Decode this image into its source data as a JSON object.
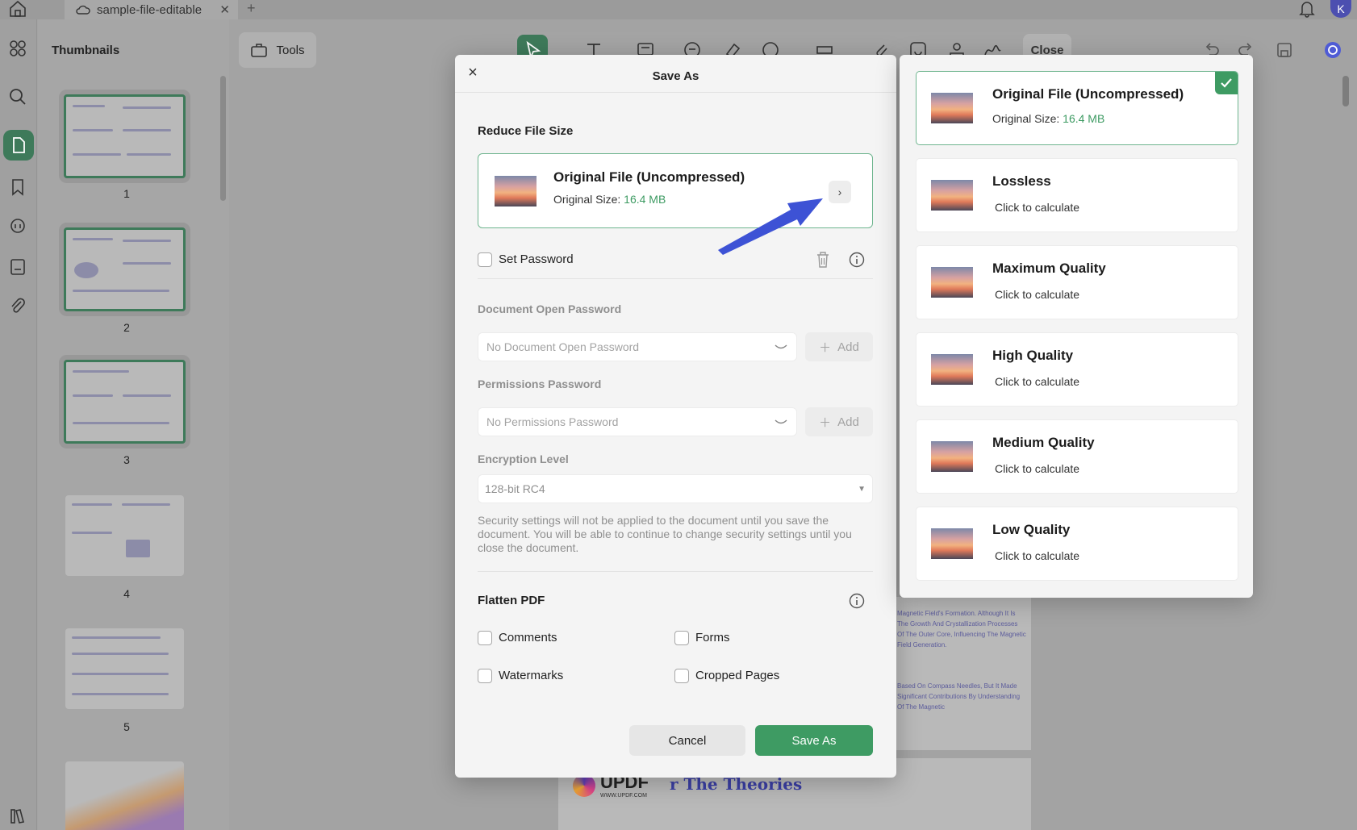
{
  "tab": {
    "title": "sample-file-editable"
  },
  "user": {
    "avatar_initial": "K"
  },
  "thumbnails": {
    "title": "Thumbnails",
    "pages": [
      "1",
      "2",
      "3",
      "4",
      "5"
    ]
  },
  "tools": {
    "label": "Tools"
  },
  "toolbar": {
    "close_label": "Close"
  },
  "document": {
    "logo_name": "UPDF",
    "logo_url": "WWW.UPDF.COM",
    "heading_fragment": "r The Theories",
    "snippet_1": "Magnetic Field's Formation. Although It Is The Growth And Crystallization Processes Of The Outer Core, Influencing The Magnetic Field Generation.",
    "snippet_2": "Based On Compass Needles, But It Made Significant Contributions By Understanding Of The Magnetic"
  },
  "dialog": {
    "title": "Save As",
    "reduce_label": "Reduce File Size",
    "selected": {
      "title": "Original File (Uncompressed)",
      "size_prefix": "Original Size: ",
      "size_value": "16.4 MB"
    },
    "set_password_label": "Set Password",
    "open_pw_label": "Document Open Password",
    "open_pw_placeholder": "No Document Open Password",
    "perm_pw_label": "Permissions Password",
    "perm_pw_placeholder": "No Permissions Password",
    "add_label": "Add",
    "encryption_label": "Encryption Level",
    "encryption_value": "128-bit RC4",
    "security_note": "Security settings will not be applied to the document until you save the document. You will be able to continue to change security settings until you close the document.",
    "flatten_label": "Flatten PDF",
    "flatten": {
      "comments": "Comments",
      "forms": "Forms",
      "watermarks": "Watermarks",
      "cropped": "Cropped Pages"
    },
    "cancel_label": "Cancel",
    "save_label": "Save As"
  },
  "options": [
    {
      "title": "Original File (Uncompressed)",
      "sub_prefix": "Original Size: ",
      "sub_value": "16.4 MB",
      "selected": true
    },
    {
      "title": "Lossless",
      "sub": "Click to calculate"
    },
    {
      "title": "Maximum Quality",
      "sub": "Click to calculate"
    },
    {
      "title": "High Quality",
      "sub": "Click to calculate"
    },
    {
      "title": "Medium Quality",
      "sub": "Click to calculate"
    },
    {
      "title": "Low Quality",
      "sub": "Click to calculate"
    }
  ],
  "colors": {
    "accent": "#3e9b63",
    "annotation_arrow": "#3d52d5"
  }
}
